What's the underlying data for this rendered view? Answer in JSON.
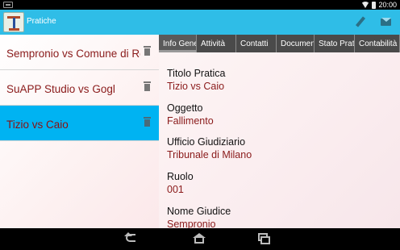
{
  "status_bar": {
    "time": "20:00",
    "icons": [
      "notification-icon",
      "wifi-icon",
      "battery-icon"
    ]
  },
  "action_bar": {
    "title": "Pratiche",
    "icons": [
      "app-logo-icon",
      "pencil-icon",
      "mail-icon"
    ]
  },
  "list": {
    "items": [
      {
        "label": "Sempronio vs Comune di Roma",
        "selected": false
      },
      {
        "label": "SuAPP Studio vs Gogl",
        "selected": false
      },
      {
        "label": "Tizio vs Caio",
        "selected": true
      }
    ]
  },
  "tabs": [
    {
      "label": "Info Generali",
      "active": true
    },
    {
      "label": "Attività",
      "active": false
    },
    {
      "label": "Contatti",
      "active": false
    },
    {
      "label": "Documenti",
      "active": false
    },
    {
      "label": "Stato Pratica",
      "active": false
    },
    {
      "label": "Contabilità",
      "active": false
    }
  ],
  "details": {
    "fields": [
      {
        "label": "Titolo Pratica",
        "value": "Tizio vs Caio"
      },
      {
        "label": "Oggetto",
        "value": "Fallimento"
      },
      {
        "label": "Ufficio Giudiziario",
        "value": "Tribunale di Milano"
      },
      {
        "label": "Ruolo",
        "value": "001"
      },
      {
        "label": "Nome Giudice",
        "value": "Sempronio"
      }
    ]
  },
  "colors": {
    "action_bar": "#2fbde7",
    "selected_row": "#00b3f2",
    "value_text": "#8a1a1a",
    "tab_bg": "#4a4a4a"
  }
}
